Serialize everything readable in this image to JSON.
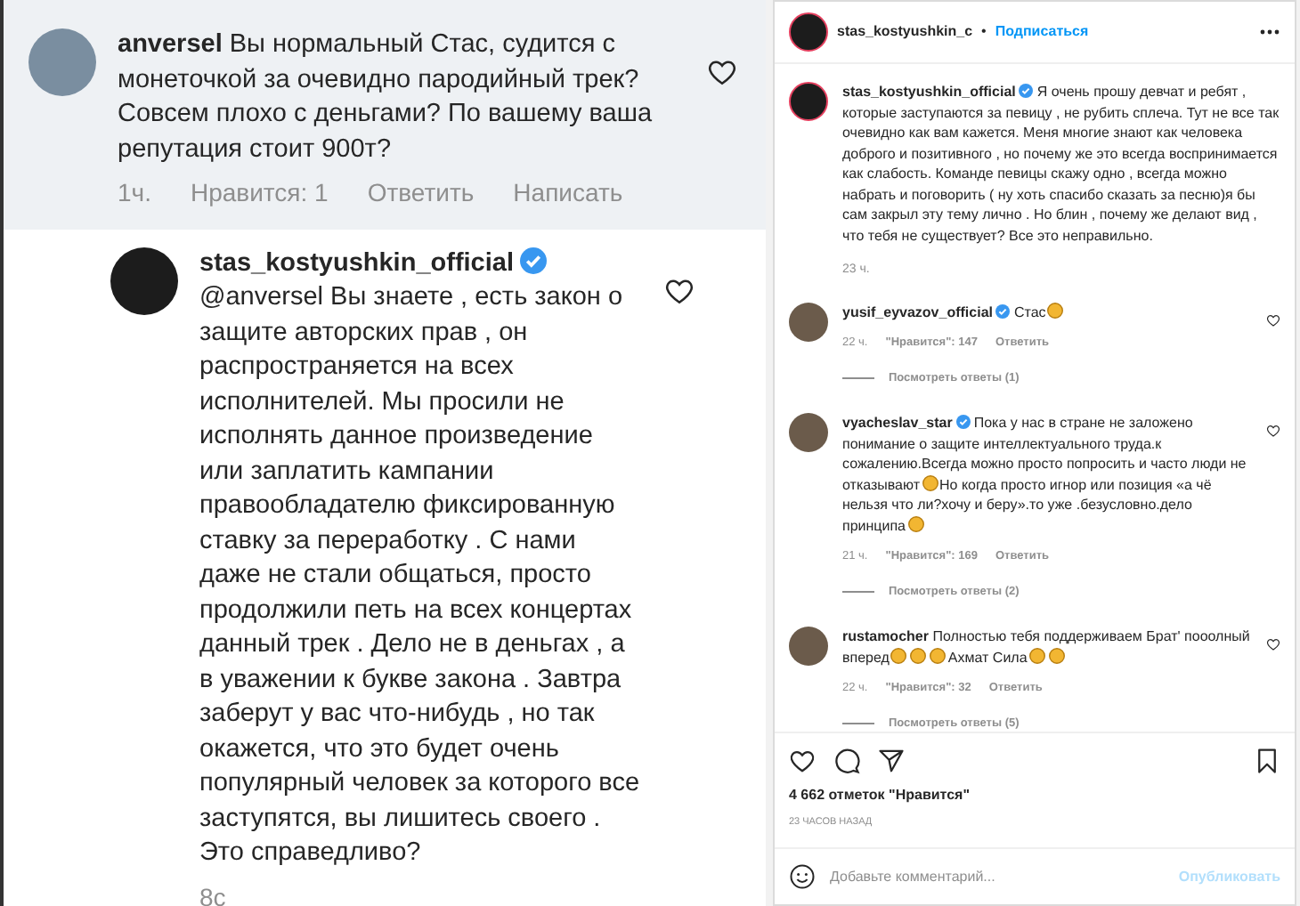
{
  "zoomed_thread": {
    "comments": [
      {
        "username": "anversel",
        "verified": false,
        "highlighted": true,
        "is_reply": false,
        "text": "Вы нормальный Стас, судится с монеточкой за очевидно пародийный трек? Совсем плохо с деньгами? По вашему ваша репутация стоит 900т?",
        "time": "1ч.",
        "likes": "Нравится: 1",
        "reply": "Ответить",
        "message": "Написать"
      },
      {
        "username": "stas_kostyushkin_official",
        "verified": true,
        "highlighted": false,
        "is_reply": true,
        "text": "@anversel Вы знаете , есть закон о защите авторских прав , он распространяется на всех исполнителей. Мы просили не исполнять данное произведение или заплатить кампании правообладателю фиксированную ставку за переработку . С нами даже не стали общаться, просто продолжили петь на всех концертах данный трек . Дело не в деньгах , а в уважении к букве закона . Завтра заберут у вас что-нибудь , но так окажется, что это будет очень популярный человек за которого все заступятся, вы лишитесь своего . Это справедливо?",
        "time": "8с"
      }
    ]
  },
  "post": {
    "header": {
      "username": "stas_kostyushkin_c",
      "separator": "•",
      "follow": "Подписаться"
    },
    "caption": {
      "username": "stas_kostyushkin_official",
      "verified": true,
      "text": "Я очень прошу девчат и ребят , которые заступаются за певицу , не рубить сплеча. Тут не все так очевидно как вам кажется. Меня многие знают как человека доброго и позитивного , но почему же это всегда воспринимается как слабость. Команде певицы скажу одно , всегда можно набрать и поговорить ( ну хоть спасибо сказать за песню)я бы сам закрыл эту тему лично . Но блин , почему же делают вид , что тебя не существует? Все это неправильно.",
      "time": "23 ч."
    },
    "comments": [
      {
        "username": "yusif_eyvazov_official",
        "verified": true,
        "parts": [
          {
            "kind": "text",
            "text": "Стас"
          },
          {
            "kind": "emoji"
          }
        ],
        "time": "22 ч.",
        "likes": "\"Нравится\": 147",
        "reply": "Ответить",
        "view_replies": "Посмотреть ответы (1)"
      },
      {
        "username": "vyacheslav_star",
        "verified": true,
        "parts": [
          {
            "kind": "text",
            "text": "Пока у нас в стране не заложено понимание о защите интеллектуального труда.к сожалению.Всегда можно просто попросить и часто люди не отказывают"
          },
          {
            "kind": "emoji"
          },
          {
            "kind": "text",
            "text": "Но когда просто игнор или позиция «а чё нельзя что ли?хочу и беру».то уже .безусловно.дело принципа"
          },
          {
            "kind": "emoji"
          }
        ],
        "time": "21 ч.",
        "likes": "\"Нравится\": 169",
        "reply": "Ответить",
        "view_replies": "Посмотреть ответы (2)"
      },
      {
        "username": "rustamocher",
        "verified": false,
        "parts": [
          {
            "kind": "text",
            "text": "Полностью тебя поддерживаем Брат' пооолный вперед"
          },
          {
            "kind": "emoji"
          },
          {
            "kind": "emoji"
          },
          {
            "kind": "emoji"
          },
          {
            "kind": "text",
            "text": "Ахмат Сила"
          },
          {
            "kind": "emoji"
          },
          {
            "kind": "emoji"
          }
        ],
        "time": "22 ч.",
        "likes": "\"Нравится\": 32",
        "reply": "Ответить",
        "view_replies": "Посмотреть ответы (5)"
      }
    ],
    "likes": "4 662 отметок \"Нравится\"",
    "posted": "23 ЧАСОВ НАЗАД",
    "comment_field": {
      "placeholder": "Добавьте комментарий..."
    },
    "publish": {
      "label": "Опубликовать",
      "disabled": true
    }
  }
}
